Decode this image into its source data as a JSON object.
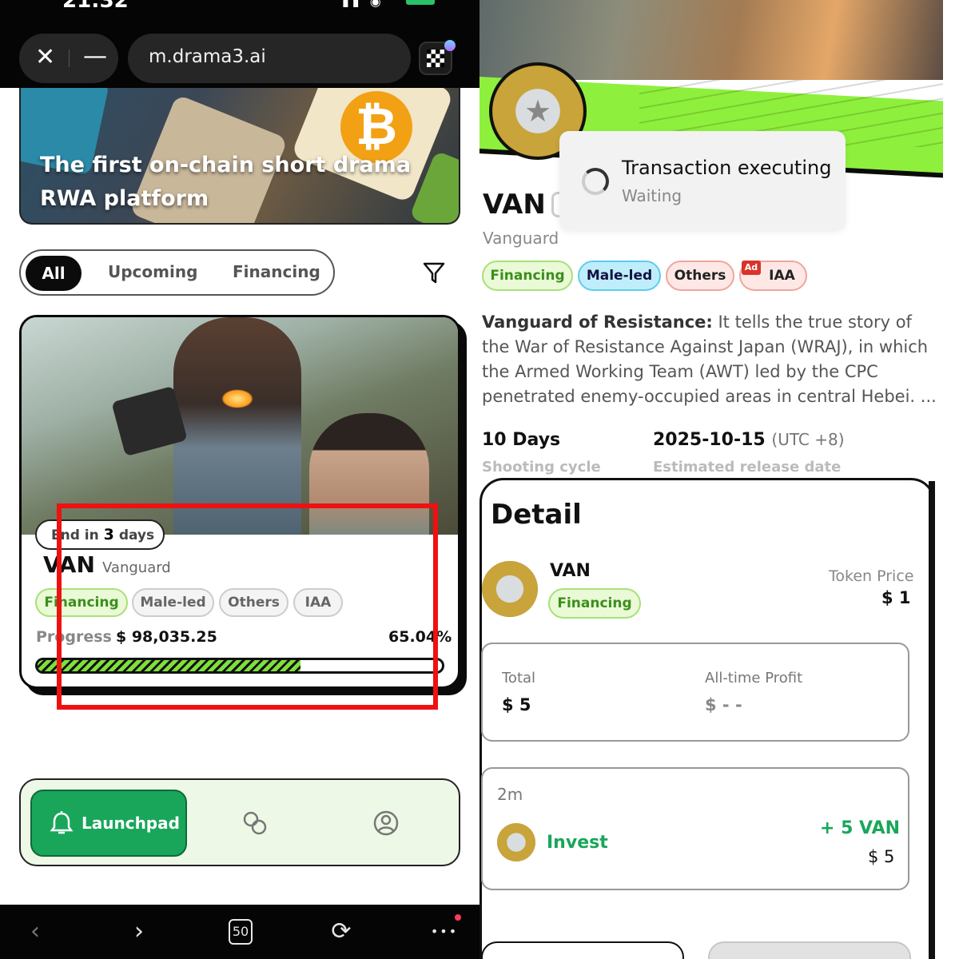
{
  "left": {
    "status": {
      "time": "21:32",
      "icons": "▮▮ ◉"
    },
    "browser": {
      "close": "✕",
      "minimize": "—",
      "url": "m.drama3.ai"
    },
    "hero": {
      "title": "The first on-chain short drama RWA platform"
    },
    "tabs": [
      {
        "label": "All",
        "selected": true
      },
      {
        "label": "Upcoming",
        "selected": false
      },
      {
        "label": "Financing",
        "selected": false
      }
    ],
    "card": {
      "end_prefix": "End in",
      "end_days": "3",
      "end_suffix": "days",
      "symbol": "VAN",
      "name": "Vanguard",
      "tags": [
        "Financing",
        "Male-led",
        "Others",
        "IAA"
      ],
      "progress_label": "Progress",
      "amount": "$ 98,035.25",
      "percent": "65.04%",
      "progress_fraction": 0.65
    },
    "bottom_nav": {
      "launchpad": "Launchpad"
    },
    "system_nav": {
      "back": "‹",
      "forward": "›",
      "tab_count": "50",
      "refresh": "⟳",
      "more": "•••"
    }
  },
  "right": {
    "toast": {
      "title": "Transaction executing",
      "subtitle": "Waiting"
    },
    "symbol": "VAN",
    "name": "Vanguard",
    "tags": {
      "financing": "Financing",
      "male": "Male-led",
      "others": "Others",
      "ad": "Ad",
      "iaa": "IAA"
    },
    "description": {
      "title": "Vanguard of Resistance:",
      "body": " It tells the true story of the War of Resistance Against Japan (WRAJ), in which the Armed Working Team (AWT) led by the CPC penetrated enemy-occupied areas in central Hebei. ..."
    },
    "stats": {
      "cycle_value": "10 Days",
      "cycle_label": "Shooting cycle",
      "release_value": "2025-10-15",
      "release_tz": "(UTC +8)",
      "release_label": "Estimated release date"
    },
    "detail": {
      "title": "Detail",
      "symbol": "VAN",
      "status": "Financing",
      "token_price_label": "Token Price",
      "token_price": "$ 1",
      "total_label": "Total",
      "total_value": "$ 5",
      "profit_label": "All-time Profit",
      "profit_value": "$ - -",
      "tx_time": "2m",
      "tx_type": "Invest",
      "tx_amount": "+ 5 VAN",
      "tx_usd": "$ 5"
    }
  },
  "colors": {
    "accent_green": "#19a65a",
    "highlight_red": "#ee1111",
    "lime": "#8ef03c"
  }
}
